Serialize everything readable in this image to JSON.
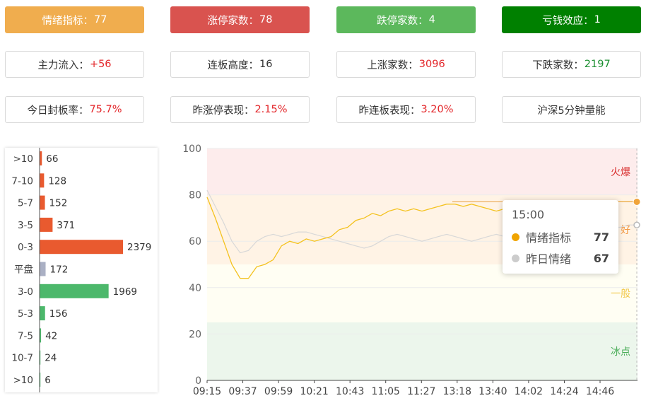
{
  "colors": {
    "sentiment_card": "#f0ad4e",
    "limit_up_card": "#d9534f",
    "limit_down_card": "#5cb85c",
    "loss_effect_card": "#008000",
    "dist_up_bar": "#e95a2f",
    "dist_flat_bar": "#aab0c4",
    "dist_down_bar": "#4cb86b",
    "line_today": "#f4c21e",
    "line_yesterday": "#d8d8d8",
    "marker_today": "#f0a43a",
    "zone_hot": "#fdecec",
    "zone_good": "#fff3e5",
    "zone_normal": "#fffef3",
    "zone_cold": "#ecf6ec"
  },
  "stat_cards": [
    {
      "label": "情绪指标：",
      "value": "77",
      "style": "filled",
      "bg": "#f0ad4e"
    },
    {
      "label": "涨停家数：",
      "value": "78",
      "style": "filled",
      "bg": "#d9534f"
    },
    {
      "label": "跌停家数：",
      "value": "4",
      "style": "filled",
      "bg": "#5cb85c"
    },
    {
      "label": "亏钱效应：",
      "value": "1",
      "style": "filled",
      "bg": "#008000"
    },
    {
      "label": "主力流入：",
      "value": "+56",
      "style": "red"
    },
    {
      "label": "连板高度：",
      "value": "16",
      "style": "plain"
    },
    {
      "label": "上涨家数：",
      "value": "3096",
      "style": "red"
    },
    {
      "label": "下跌家数：",
      "value": "2197",
      "style": "green"
    },
    {
      "label": "今日封板率：",
      "value": "75.7%",
      "style": "red"
    },
    {
      "label": "昨涨停表现：",
      "value": "2.15%",
      "style": "red"
    },
    {
      "label": "昨连板表现：",
      "value": "3.20%",
      "style": "red"
    },
    {
      "label": "沪深5分钟量能",
      "value": "",
      "style": "plain"
    }
  ],
  "chart_data": [
    {
      "type": "bar",
      "orientation": "horizontal",
      "categories": [
        ">10",
        "7-10",
        "5-7",
        "3-5",
        "0-3",
        "平盘",
        "3-0",
        "5-3",
        "7-5",
        "10-7",
        ">10"
      ],
      "values": [
        66,
        128,
        152,
        371,
        2379,
        172,
        1969,
        156,
        42,
        24,
        6
      ],
      "groups": [
        "up",
        "up",
        "up",
        "up",
        "up",
        "flat",
        "down",
        "down",
        "down",
        "down",
        "down"
      ]
    },
    {
      "type": "line",
      "xlabel": "",
      "ylabel": "",
      "ylim": [
        0,
        100
      ],
      "yticks": [
        0,
        20,
        40,
        60,
        80,
        100
      ],
      "xtick_labels": [
        "09:15",
        "09:37",
        "09:59",
        "10:21",
        "10:43",
        "11:05",
        "11:27",
        "13:18",
        "13:40",
        "14:02",
        "14:24",
        "14:46"
      ],
      "zones": [
        {
          "label": "火爆",
          "from": 80,
          "to": 100,
          "label_color": "#d93030"
        },
        {
          "label": "好",
          "from": 50,
          "to": 80,
          "label_color": "#f39a45"
        },
        {
          "label": "一般",
          "from": 25,
          "to": 50,
          "label_color": "#f2c94c"
        },
        {
          "label": "冰点",
          "from": 0,
          "to": 25,
          "label_color": "#4cae5a"
        }
      ],
      "grid": true,
      "series": [
        {
          "name": "情绪指标",
          "values": [
            79,
            70,
            60,
            50,
            44,
            44,
            49,
            50,
            52,
            58,
            60,
            59,
            61,
            60,
            61,
            62,
            65,
            66,
            69,
            70,
            72,
            71,
            73,
            74,
            73,
            74,
            73,
            74,
            75,
            76,
            76,
            75,
            76,
            75,
            74,
            73,
            74,
            73,
            72,
            74,
            73,
            74,
            75,
            74,
            75,
            74,
            76,
            76,
            77,
            77,
            77,
            77,
            77
          ]
        },
        {
          "name": "昨日情绪",
          "values": [
            82,
            75,
            68,
            60,
            55,
            56,
            60,
            62,
            63,
            62,
            63,
            64,
            64,
            63,
            62,
            61,
            60,
            59,
            58,
            57,
            58,
            60,
            62,
            63,
            62,
            61,
            60,
            61,
            62,
            63,
            62,
            61,
            60,
            61,
            62,
            63,
            62,
            61,
            62,
            63,
            64,
            63,
            64,
            65,
            64,
            63,
            64,
            65,
            66,
            66,
            66,
            67,
            67
          ]
        }
      ]
    }
  ],
  "tooltip": {
    "time": "15:00",
    "rows": [
      {
        "name": "情绪指标",
        "value": "77",
        "color": "#f0a400"
      },
      {
        "name": "昨日情绪",
        "value": "67",
        "color": "#cccccc"
      }
    ]
  }
}
